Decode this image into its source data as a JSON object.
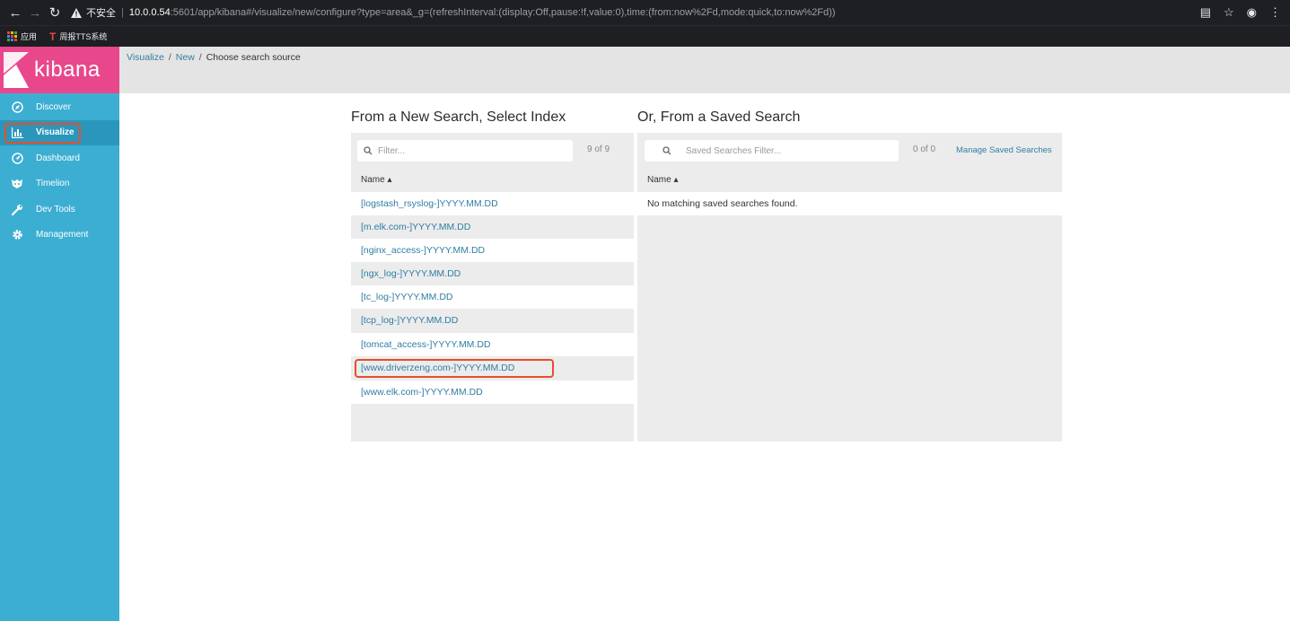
{
  "browser": {
    "insecure_label": "不安全",
    "url_host": "10.0.0.54",
    "url_rest": ":5601/app/kibana#/visualize/new/configure?type=area&_g=(refreshInterval:(display:Off,pause:!f,value:0),time:(from:now%2Fd,mode:quick,to:now%2Fd))",
    "bookmarks": [
      {
        "label": "应用",
        "icon": "apps-grid-icon"
      },
      {
        "label": "周报TTS系统",
        "icon": "t-logo-icon"
      }
    ]
  },
  "sidebar": {
    "logo_text": "kibana",
    "items": [
      {
        "label": "Discover",
        "icon": "compass-icon"
      },
      {
        "label": "Visualize",
        "icon": "bar-chart-icon"
      },
      {
        "label": "Dashboard",
        "icon": "dashboard-icon"
      },
      {
        "label": "Timelion",
        "icon": "timelion-icon"
      },
      {
        "label": "Dev Tools",
        "icon": "wrench-icon"
      },
      {
        "label": "Management",
        "icon": "gear-icon"
      }
    ],
    "active": "Visualize",
    "accent": "#3caed2",
    "logo_color": "#e8478b"
  },
  "breadcrumb": {
    "visualize": "Visualize",
    "new": "New",
    "current": "Choose search source",
    "sep": "/"
  },
  "new_search": {
    "title": "From a New Search, Select Index",
    "filter_placeholder": "Filter...",
    "count": "9 of 9",
    "name_header": "Name ▴",
    "indices": [
      "[logstash_rsyslog-]YYYY.MM.DD",
      "[m.elk.com-]YYYY.MM.DD",
      "[nginx_access-]YYYY.MM.DD",
      "[ngx_log-]YYYY.MM.DD",
      "[tc_log-]YYYY.MM.DD",
      "[tcp_log-]YYYY.MM.DD",
      "[tomcat_access-]YYYY.MM.DD",
      "[www.driverzeng.com-]YYYY.MM.DD",
      "[www.elk.com-]YYYY.MM.DD"
    ],
    "highlighted": "[www.driverzeng.com-]YYYY.MM.DD"
  },
  "saved_search": {
    "title": "Or, From a Saved Search",
    "filter_placeholder": "Saved Searches Filter...",
    "count": "0 of 0",
    "manage_link": "Manage Saved Searches",
    "name_header": "Name ▴",
    "empty_message": "No matching saved searches found."
  },
  "colors": {
    "link": "#2f7ea3",
    "highlight_border": "#e34f2d"
  }
}
